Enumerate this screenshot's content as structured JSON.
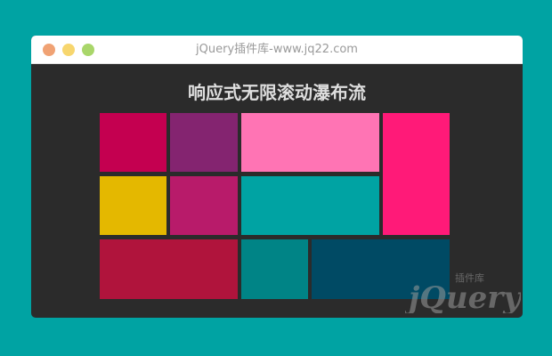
{
  "window": {
    "title": "jQuery插件库-www.jq22.com"
  },
  "page": {
    "heading": "响应式无限滚动瀑布流"
  },
  "tiles": [
    {
      "color": "#c40050"
    },
    {
      "color": "#842470"
    },
    {
      "color": "#ff74b4"
    },
    {
      "color": "#ff1a78"
    },
    {
      "color": "#e4b800"
    },
    {
      "color": "#b81b6a"
    },
    {
      "color": "#00a3a3"
    },
    {
      "color": "#b0143c"
    },
    {
      "color": "#008486"
    },
    {
      "color": "#004a64"
    }
  ],
  "watermark": {
    "logo_text": "jQuery",
    "cn_text": "插件库"
  }
}
